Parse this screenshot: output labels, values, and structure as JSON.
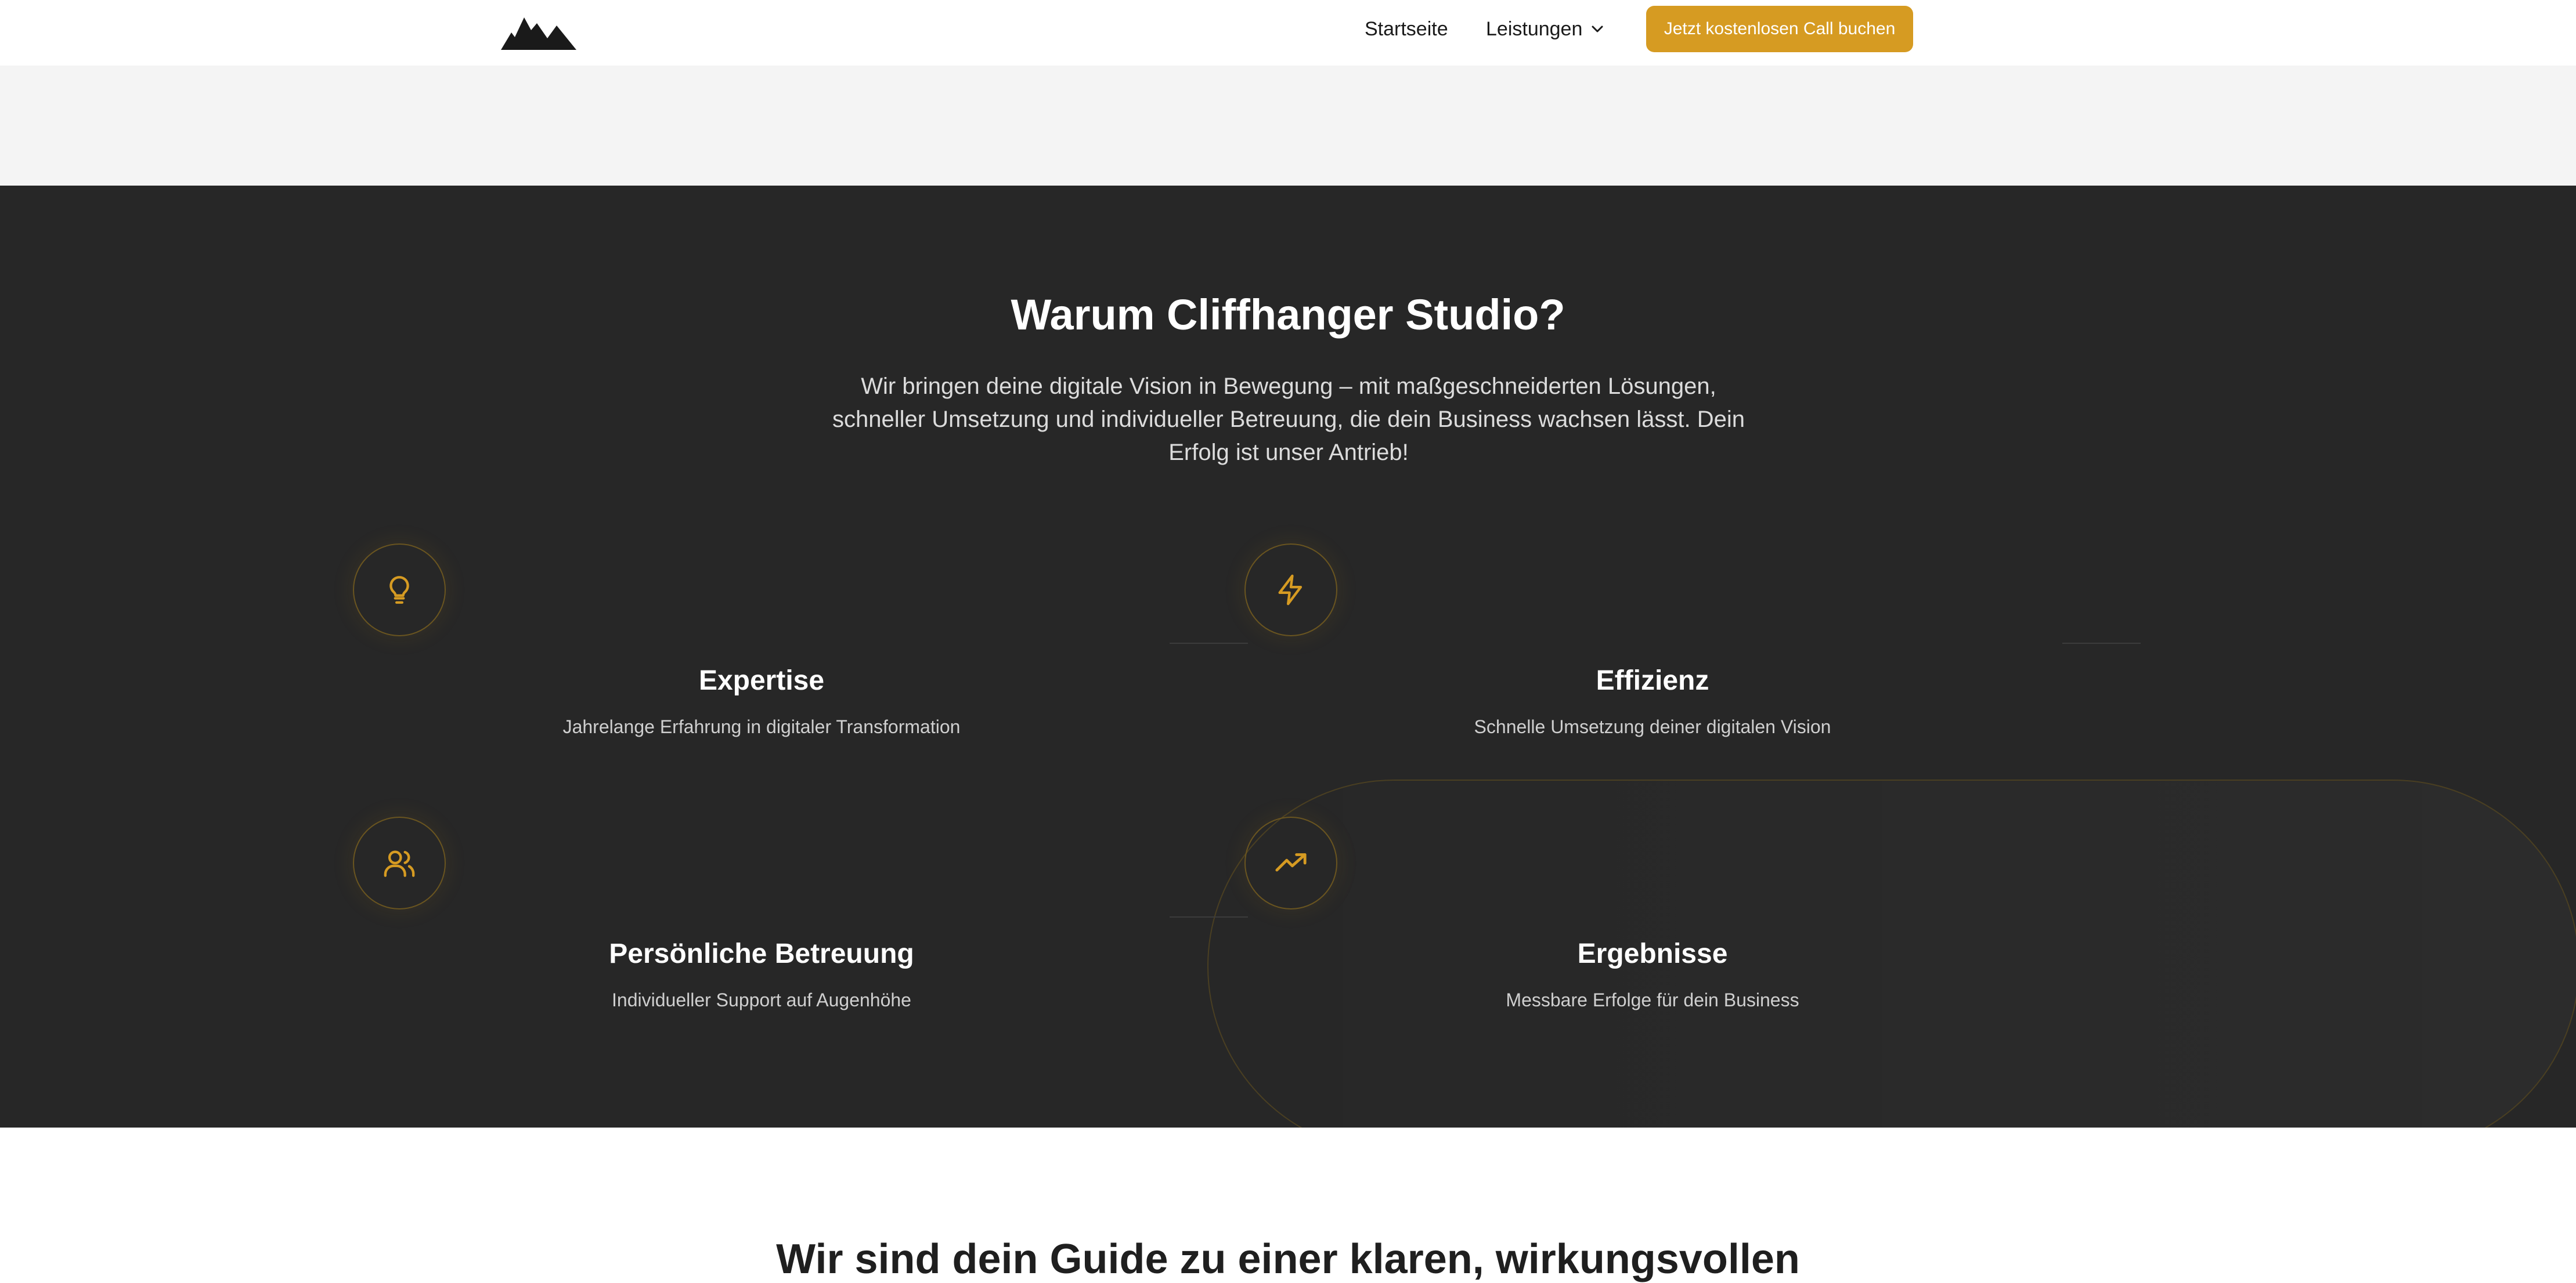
{
  "header": {
    "nav": {
      "home_label": "Startseite",
      "services_label": "Leistungen"
    },
    "cta_label": "Jetzt kostenlosen Call buchen"
  },
  "why": {
    "title": "Warum Cliffhanger Studio?",
    "lead": "Wir bringen deine digitale Vision in Bewegung – mit maßgeschneiderten Lösungen, schneller Umsetzung und individueller Betreuung, die dein Business wachsen lässt. Dein Erfolg ist unser Antrieb!",
    "features": [
      {
        "icon": "lightbulb-icon",
        "title": "Expertise",
        "desc": "Jahrelange Erfahrung in digitaler Transformation"
      },
      {
        "icon": "lightning-icon",
        "title": "Effizienz",
        "desc": "Schnelle Umsetzung deiner digitalen Vision"
      },
      {
        "icon": "users-icon",
        "title": "Persönliche Betreuung",
        "desc": "Individueller Support auf Augenhöhe"
      },
      {
        "icon": "trending-up-icon",
        "title": "Ergebnisse",
        "desc": "Messbare Erfolge für dein Business"
      }
    ]
  },
  "next_section": {
    "title": "Wir sind dein Guide zu einer klaren, wirkungsvollen"
  },
  "colors": {
    "accent": "#d69b22",
    "dark_bg": "#272727",
    "light_band": "#f4f4f4"
  }
}
